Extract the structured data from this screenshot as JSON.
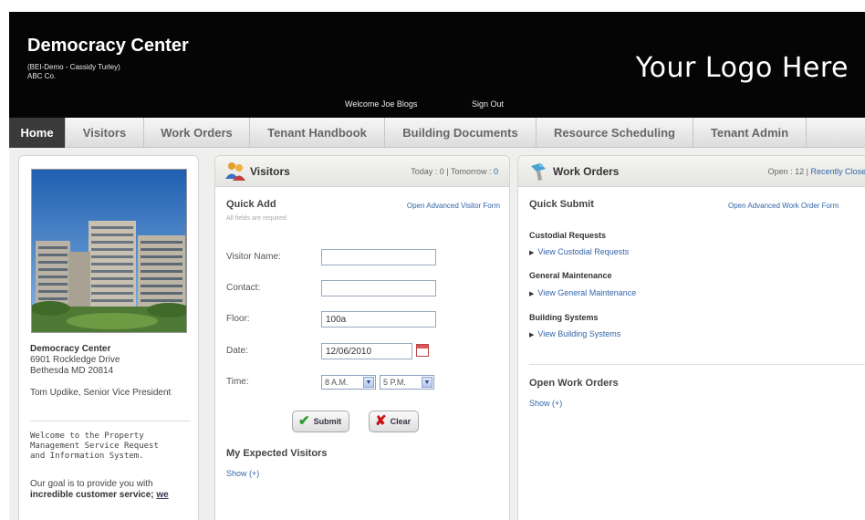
{
  "header": {
    "title": "Democracy Center",
    "subtitle1": "(BEI-Demo - Cassidy Turley)",
    "subtitle2": "ABC Co.",
    "welcome": "Welcome  Joe Blogs",
    "signout": "Sign Out",
    "logo": "Your Logo Here"
  },
  "nav": {
    "tabs": [
      {
        "label": "Home",
        "active": true
      },
      {
        "label": "Visitors"
      },
      {
        "label": "Work Orders"
      },
      {
        "label": "Tenant Handbook"
      },
      {
        "label": "Building Documents"
      },
      {
        "label": "Resource Scheduling"
      },
      {
        "label": "Tenant Admin"
      }
    ]
  },
  "building": {
    "name": "Democracy Center",
    "address1": "6901 Rockledge Drive",
    "address2": "Bethesda MD 20814",
    "contact": "Tom Updike, Senior Vice President",
    "welcome_text": "Welcome to the Property Management Service Request and Information System.",
    "goal_text": "Our goal is to provide you with",
    "goal_bold": "incredible customer service;",
    "goal_link": "we"
  },
  "visitors": {
    "title": "Visitors",
    "today": "Today : 0",
    "separator": " | ",
    "tomorrow_label": "Tomorrow : ",
    "tomorrow_value": "0",
    "quick_add": "Quick Add",
    "advanced_link": "Open Advanced Visitor Form",
    "required_hint": "All fields are required",
    "labels": {
      "name": "Visitor Name:",
      "contact": "Contact:",
      "floor": "Floor:",
      "date": "Date:",
      "time": "Time:"
    },
    "values": {
      "name": "",
      "contact": "",
      "floor": "100a",
      "date": "12/06/2010",
      "time_from": "8 A.M.",
      "time_to": "5 P.M."
    },
    "submit": "Submit",
    "clear": "Clear",
    "expected_title": "My Expected Visitors",
    "expected_show": "Show (+)"
  },
  "work_orders": {
    "title": "Work Orders",
    "open": "Open : 12",
    "separator": "  |  ",
    "recently_closed": "Recently Closed",
    "quick_submit": "Quick Submit",
    "advanced_link": "Open Advanced Work Order Form",
    "categories": [
      {
        "title": "Custodial Requests",
        "link": "View Custodial Requests"
      },
      {
        "title": "General Maintenance",
        "link": "View General Maintenance"
      },
      {
        "title": "Building Systems",
        "link": "View Building Systems"
      }
    ],
    "open_title": "Open Work Orders",
    "open_show": "Show (+)"
  },
  "icons": {
    "visitors": "people-icon",
    "work_orders": "work-order-icon",
    "calendar": "calendar-icon",
    "submit": "checkmark-icon",
    "clear": "x-icon"
  },
  "colors": {
    "header_bg": "#050505",
    "active_tab": "#3a3a3a",
    "link": "#3366aa",
    "submit_check": "#2a9a2a",
    "clear_x": "#cc1111"
  }
}
